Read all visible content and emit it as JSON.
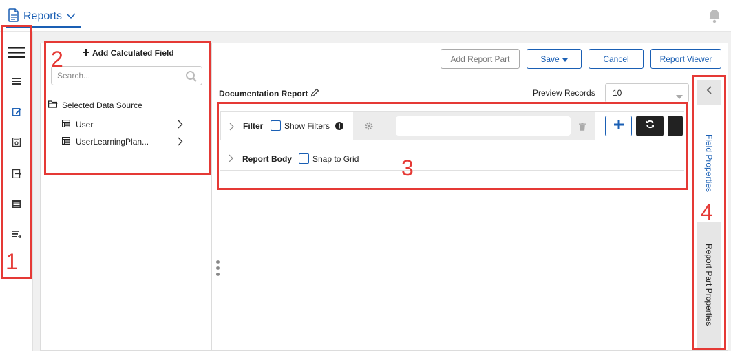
{
  "topbar": {
    "title": "Reports",
    "icons": {
      "document": "document-icon",
      "chevron": "chevron-down-icon",
      "bell": "bell-icon"
    }
  },
  "rail": {
    "items": [
      {
        "name": "hamburger-menu-icon"
      },
      {
        "name": "list-icon"
      },
      {
        "name": "edit-icon"
      },
      {
        "name": "report-settings-icon"
      },
      {
        "name": "export-icon"
      },
      {
        "name": "calendar-icon"
      },
      {
        "name": "sort-list-icon"
      }
    ]
  },
  "data_panel": {
    "add_calculated_field": "Add Calculated Field",
    "search_placeholder": "Search...",
    "selected_data_source": "Selected Data Source",
    "items": [
      {
        "label": "User"
      },
      {
        "label": "UserLearningPlan..."
      }
    ]
  },
  "toolbar": {
    "add_report_part": "Add Report Part",
    "save": "Save",
    "cancel": "Cancel",
    "report_viewer": "Report Viewer"
  },
  "report": {
    "title": "Documentation Report",
    "preview_label": "Preview Records",
    "preview_value": "10"
  },
  "filter_row": {
    "label": "Filter",
    "show_filters": "Show Filters"
  },
  "body_row": {
    "label": "Report Body",
    "snap_to_grid": "Snap to Grid"
  },
  "side_panel": {
    "tabs": [
      {
        "label": "Field Properties",
        "active": true
      },
      {
        "label": "Report Part Properties",
        "active": false
      }
    ]
  },
  "annotations": [
    "1",
    "2",
    "3",
    "4"
  ],
  "colors": {
    "accent": "#1a5fb4",
    "annotation": "#e53935",
    "dark_button": "#222222"
  }
}
